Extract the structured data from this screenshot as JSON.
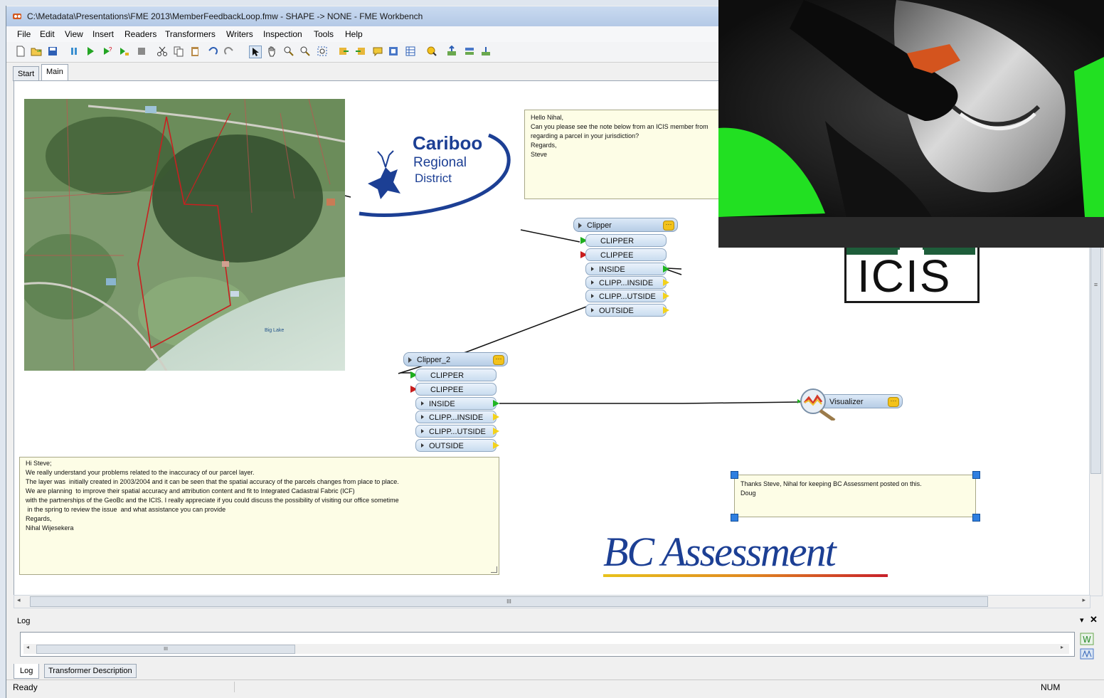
{
  "window": {
    "title": "C:\\Metadata\\Presentations\\FME 2013\\MemberFeedbackLoop.fmw - SHAPE -> NONE - FME Workbench"
  },
  "menu": [
    "File",
    "Edit",
    "View",
    "Insert",
    "Readers",
    "Transformers",
    "Writers",
    "Inspection",
    "Tools",
    "Help"
  ],
  "tabs": {
    "start": "Start",
    "main": "Main"
  },
  "map": {
    "lake_label": "Big Lake"
  },
  "logos": {
    "cariboo_line1": "Cariboo",
    "cariboo_line2": "Regional",
    "cariboo_line3": "District",
    "icis": "ICIS",
    "bc_assessment": "BC Assessment"
  },
  "note_top": {
    "lines": [
      "Hello Nihal,",
      "",
      "Can you please see the note below from an ICIS member from",
      "regarding a parcel in your jurisdiction?",
      "",
      "Regards,",
      "",
      "Steve"
    ]
  },
  "clipper": {
    "name": "Clipper",
    "inputs": [
      "CLIPPER",
      "CLIPPEE"
    ],
    "outputs": [
      "INSIDE",
      "CLIPP...INSIDE",
      "CLIPP...UTSIDE",
      "OUTSIDE"
    ]
  },
  "clipper2": {
    "name": "Clipper_2",
    "inputs": [
      "CLIPPER",
      "CLIPPEE"
    ],
    "outputs": [
      "INSIDE",
      "CLIPP...INSIDE",
      "CLIPP...UTSIDE",
      "OUTSIDE"
    ]
  },
  "visualizer": {
    "name": "Visualizer"
  },
  "note_nihal": {
    "lines": [
      "Hi Steve;",
      "",
      "We really understand your problems related to the inaccuracy of our parcel layer.",
      "The layer was  initially created in 2003/2004 and it can be seen that the spatial accuracy of the parcels changes from place to place.",
      "We are planning  to improve their spatial accuracy and attribution content and fit to Integrated Cadastral Fabric (ICF)",
      "with the partnerships of the GeoBc and the ICIS. I really appreciate if you could discuss the possibility of visiting our office sometime",
      " in the spring to review the issue  and what assistance you can provide",
      "",
      "Regards,",
      "",
      "Nihal Wijesekera"
    ]
  },
  "note_doug": {
    "lines": [
      "Thanks Steve, Nihal for keeping BC Assessment posted on this.",
      "",
      "Doug"
    ]
  },
  "scroll": {
    "h_grip": "III",
    "log_grip": "III",
    "v_grip": "≡"
  },
  "log": {
    "title": "Log",
    "tab_log": "Log",
    "tab_desc": "Transformer Description"
  },
  "status": {
    "left": "Ready",
    "num": "NUM"
  },
  "colors": {
    "canvas": "#ffffff",
    "note": "#fdfde6",
    "accent": "#1c3f94"
  }
}
